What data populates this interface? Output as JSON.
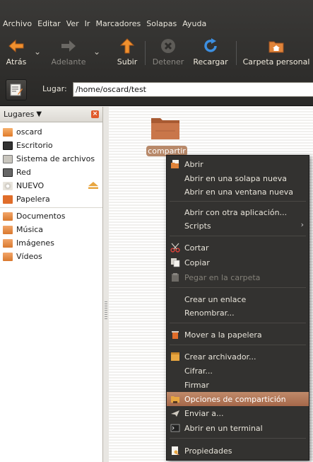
{
  "menubar": [
    "Archivo",
    "Editar",
    "Ver",
    "Ir",
    "Marcadores",
    "Solapas",
    "Ayuda"
  ],
  "toolbar": {
    "back": "Atrás",
    "forward": "Adelante",
    "up": "Subir",
    "stop": "Detener",
    "reload": "Recargar",
    "home": "Carpeta personal"
  },
  "location": {
    "label": "Lugar:",
    "value": "/home/oscard/test"
  },
  "sidebar": {
    "header": "Lugares",
    "items": [
      {
        "label": "oscard",
        "icon": "home-folder-icon"
      },
      {
        "label": "Escritorio",
        "icon": "desktop-icon"
      },
      {
        "label": "Sistema de archivos",
        "icon": "drive-icon"
      },
      {
        "label": "Red",
        "icon": "network-icon"
      },
      {
        "label": "NUEVO",
        "icon": "cd-icon"
      },
      {
        "label": "Papelera",
        "icon": "trash-icon"
      }
    ],
    "bookmarks": [
      {
        "label": "Documentos",
        "icon": "folder-icon"
      },
      {
        "label": "Música",
        "icon": "folder-icon"
      },
      {
        "label": "Imágenes",
        "icon": "folder-icon"
      },
      {
        "label": "Vídeos",
        "icon": "folder-icon"
      }
    ]
  },
  "file": {
    "name": "compartir"
  },
  "context_menu": {
    "items": [
      {
        "label": "Abrir",
        "icon": "open-icon"
      },
      {
        "label": "Abrir en una solapa nueva"
      },
      {
        "label": "Abrir en una ventana nueva"
      },
      {
        "label": "Abrir con otra aplicación..."
      },
      {
        "label": "Scripts",
        "submenu": true
      },
      {
        "label": "Cortar",
        "icon": "scissors-icon"
      },
      {
        "label": "Copiar",
        "icon": "copy-icon"
      },
      {
        "label": "Pegar en la carpeta",
        "icon": "paste-icon",
        "disabled": true
      },
      {
        "label": "Crear un enlace"
      },
      {
        "label": "Renombrar..."
      },
      {
        "label": "Mover a la papelera",
        "icon": "trash-icon"
      },
      {
        "label": "Crear archivador...",
        "icon": "archive-icon"
      },
      {
        "label": "Cifrar..."
      },
      {
        "label": "Firmar"
      },
      {
        "label": "Opciones de compartición",
        "icon": "share-folder-icon",
        "highlighted": true
      },
      {
        "label": "Enviar a...",
        "icon": "send-icon"
      },
      {
        "label": "Abrir en un terminal",
        "icon": "terminal-icon"
      },
      {
        "label": "Propiedades",
        "icon": "properties-icon"
      }
    ]
  },
  "colors": {
    "chrome": "#2f2e2c",
    "accent": "#b8896a",
    "menu_bg": "#333230",
    "folder": "#c9764a"
  }
}
